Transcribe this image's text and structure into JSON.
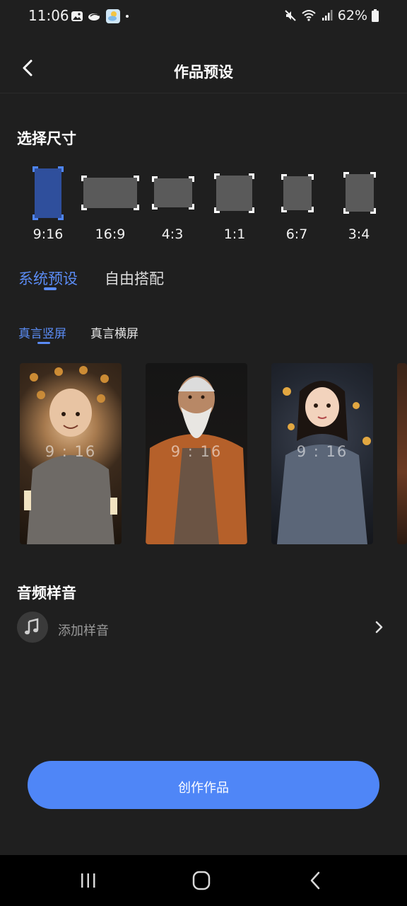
{
  "status_bar": {
    "time": "11:06",
    "battery": "62%",
    "icons": [
      "gallery-icon",
      "cloud-icon",
      "weather-icon",
      "dot-icon",
      "mute-icon",
      "wifi-icon",
      "signal-icon",
      "battery-icon"
    ]
  },
  "header": {
    "title": "作品预设",
    "back_icon": "chevron-left-icon"
  },
  "size_section": {
    "title": "选择尺寸",
    "selected": "9:16",
    "options": [
      {
        "label": "9:16",
        "active": true
      },
      {
        "label": "16:9",
        "active": false
      },
      {
        "label": "4:3",
        "active": false
      },
      {
        "label": "1:1",
        "active": false
      },
      {
        "label": "6:7",
        "active": false
      },
      {
        "label": "3:4",
        "active": false
      }
    ]
  },
  "tabs": {
    "items": [
      {
        "label": "系统预设",
        "active": true
      },
      {
        "label": "自由搭配",
        "active": false
      }
    ]
  },
  "subtabs": {
    "items": [
      {
        "label": "真言竖屏",
        "active": true
      },
      {
        "label": "真言横屏",
        "active": false
      }
    ]
  },
  "presets": [
    {
      "ratio": "9 : 16",
      "subject": "child-monk-portrait"
    },
    {
      "ratio": "9 : 16",
      "subject": "elder-sage-portrait"
    },
    {
      "ratio": "9 : 16",
      "subject": "girl-hanfu-portrait"
    }
  ],
  "audio": {
    "title": "音频样音",
    "add_label": "添加样音",
    "icon": "music-note-icon"
  },
  "create_button": {
    "label": "创作作品"
  },
  "colors": {
    "accent": "#4f86f7",
    "tab_active": "#5b8cf5",
    "background": "#1f1f1f"
  }
}
